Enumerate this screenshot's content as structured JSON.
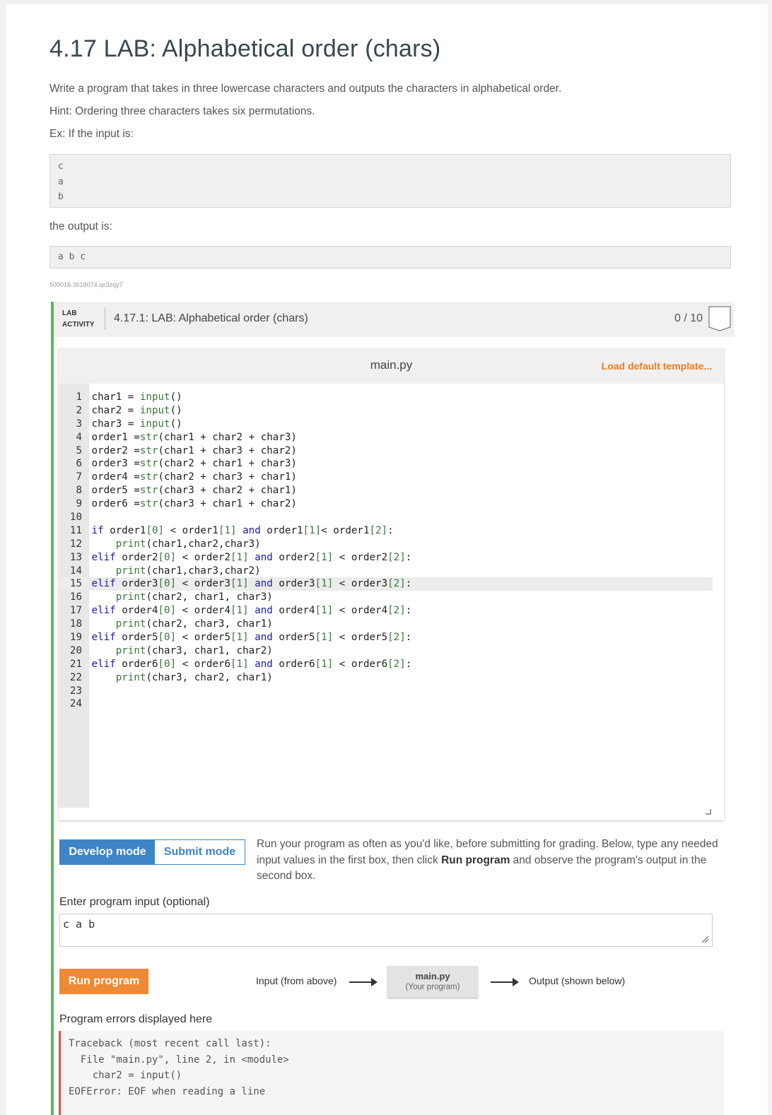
{
  "title": "4.17 LAB: Alphabetical order (chars)",
  "description": "Write a program that takes in three lowercase characters and outputs the characters in alphabetical order.",
  "hint": "Hint: Ordering three characters takes six permutations.",
  "ex_intro": "Ex: If the input is:",
  "example_input": [
    "c",
    "a",
    "b"
  ],
  "output_intro": "the output is:",
  "example_output": "a b c",
  "tracking_tag": "509018.3618074.qx3zqy7",
  "lab": {
    "tag_line1": "LAB",
    "tag_line2": "ACTIVITY",
    "title": "4.17.1: LAB: Alphabetical order (chars)",
    "score": "0 / 10"
  },
  "editor": {
    "filename": "main.py",
    "load_template": "Load default template...",
    "lines": [
      {
        "n": "1",
        "t": "char1 = input()"
      },
      {
        "n": "2",
        "t": "char2 = input()"
      },
      {
        "n": "3",
        "t": "char3 = input()"
      },
      {
        "n": "4",
        "t": "order1 =str(char1 + char2 + char3)"
      },
      {
        "n": "5",
        "t": "order2 =str(char1 + char3 + char2)"
      },
      {
        "n": "6",
        "t": "order3 =str(char2 + char1 + char3)"
      },
      {
        "n": "7",
        "t": "order4 =str(char2 + char3 + char1)"
      },
      {
        "n": "8",
        "t": "order5 =str(char3 + char2 + char1)"
      },
      {
        "n": "9",
        "t": "order6 =str(char3 + char1 + char2)"
      },
      {
        "n": "10",
        "t": ""
      },
      {
        "n": "11",
        "t": "if order1[0] < order1[1] and order1[1]< order1[2]:"
      },
      {
        "n": "12",
        "t": "    print(char1,char2,char3)"
      },
      {
        "n": "13",
        "t": "elif order2[0] < order2[1] and order2[1] < order2[2]:"
      },
      {
        "n": "14",
        "t": "    print(char1,char3,char2)"
      },
      {
        "n": "15",
        "t": "elif order3[0] < order3[1] and order3[1] < order3[2]:"
      },
      {
        "n": "16",
        "t": "    print(char2, char1, char3)"
      },
      {
        "n": "17",
        "t": "elif order4[0] < order4[1] and order4[1] < order4[2]:"
      },
      {
        "n": "18",
        "t": "    print(char2, char3, char1)"
      },
      {
        "n": "19",
        "t": "elif order5[0] < order5[1] and order5[1] < order5[2]:"
      },
      {
        "n": "20",
        "t": "    print(char3, char1, char2)"
      },
      {
        "n": "21",
        "t": "elif order6[0] < order6[1] and order6[1] < order6[2]:"
      },
      {
        "n": "22",
        "t": "    print(char3, char2, char1)"
      },
      {
        "n": "23",
        "t": ""
      },
      {
        "n": "24",
        "t": ""
      }
    ],
    "highlighted_line": "15"
  },
  "modes": {
    "develop": "Develop mode",
    "submit": "Submit mode",
    "active": "develop"
  },
  "run_help_pre": "Run your program as often as you'd like, before submitting for grading. Below, type any needed input values in the first box, then click ",
  "run_help_bold": "Run program",
  "run_help_post": " and observe the program's output in the second box.",
  "input_label": "Enter program input (optional)",
  "input_value": "c a b",
  "run_button": "Run program",
  "flow": {
    "input": "Input (from above)",
    "program_name": "main.py",
    "program_sub": "(Your program)",
    "output": "Output (shown below)"
  },
  "errors_label": "Program errors displayed here",
  "error_lines": [
    "Traceback (most recent call last):",
    "  File \"main.py\", line 2, in <module>",
    "    char2 = input()",
    "EOFError: EOF when reading a line"
  ],
  "colors": {
    "accent_blue": "#3d85c6",
    "run_orange": "#ee8a35",
    "lab_green": "#5cb85c",
    "error_red": "#d9534f",
    "load_orange": "#e67e22"
  }
}
